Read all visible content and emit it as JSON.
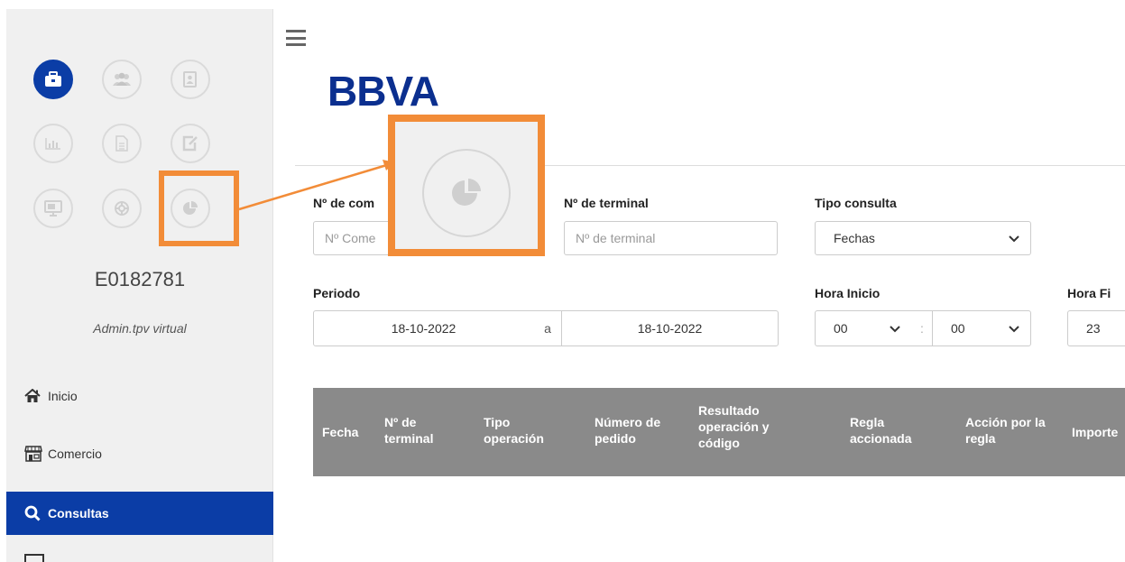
{
  "sidebar": {
    "icons": [
      {
        "name": "briefcase-icon",
        "active": true
      },
      {
        "name": "users-icon",
        "active": false
      },
      {
        "name": "contact-card-icon",
        "active": false
      },
      {
        "name": "bar-chart-icon",
        "active": false
      },
      {
        "name": "document-icon",
        "active": false
      },
      {
        "name": "edit-icon",
        "active": false
      },
      {
        "name": "monitor-icon",
        "active": false
      },
      {
        "name": "lifebuoy-icon",
        "active": false
      },
      {
        "name": "pie-chart-icon",
        "active": false
      }
    ],
    "user_id": "E0182781",
    "user_role": "Admin.tpv virtual",
    "nav": [
      {
        "label": "Inicio",
        "icon": "home-icon"
      },
      {
        "label": "Comercio",
        "icon": "store-icon"
      },
      {
        "label": "Consultas",
        "icon": "search-icon",
        "active": true
      }
    ]
  },
  "header": {
    "menu_icon": "hamburger-icon",
    "logo_text": "BBVA"
  },
  "form": {
    "comercio_label": "Nº de com",
    "comercio_placeholder": "Nº Come",
    "terminal_label": "Nº de terminal",
    "terminal_placeholder": "Nº de terminal",
    "tipo_label": "Tipo consulta",
    "tipo_value": "Fechas",
    "periodo_label": "Periodo",
    "fecha_desde": "18-10-2022",
    "separator": "a",
    "fecha_hasta": "18-10-2022",
    "hora_inicio_label": "Hora Inicio",
    "hora_inicio_h": "00",
    "time_sep": ":",
    "hora_inicio_m": "00",
    "hora_fin_label": "Hora Fi",
    "hora_fin_h": "23"
  },
  "table": {
    "headers": [
      "Fecha",
      "Nº de terminal",
      "Tipo operación",
      "Número de pedido",
      "Resultado operación y código",
      "Regla accionada",
      "Acción por la regla",
      "Importe"
    ]
  },
  "annotation": {
    "color": "#f28c38",
    "icon": "pie-chart-icon"
  },
  "colors": {
    "brand": "#0b3da6",
    "logo": "#0b2f8f",
    "table_header": "#8a8a8a"
  }
}
